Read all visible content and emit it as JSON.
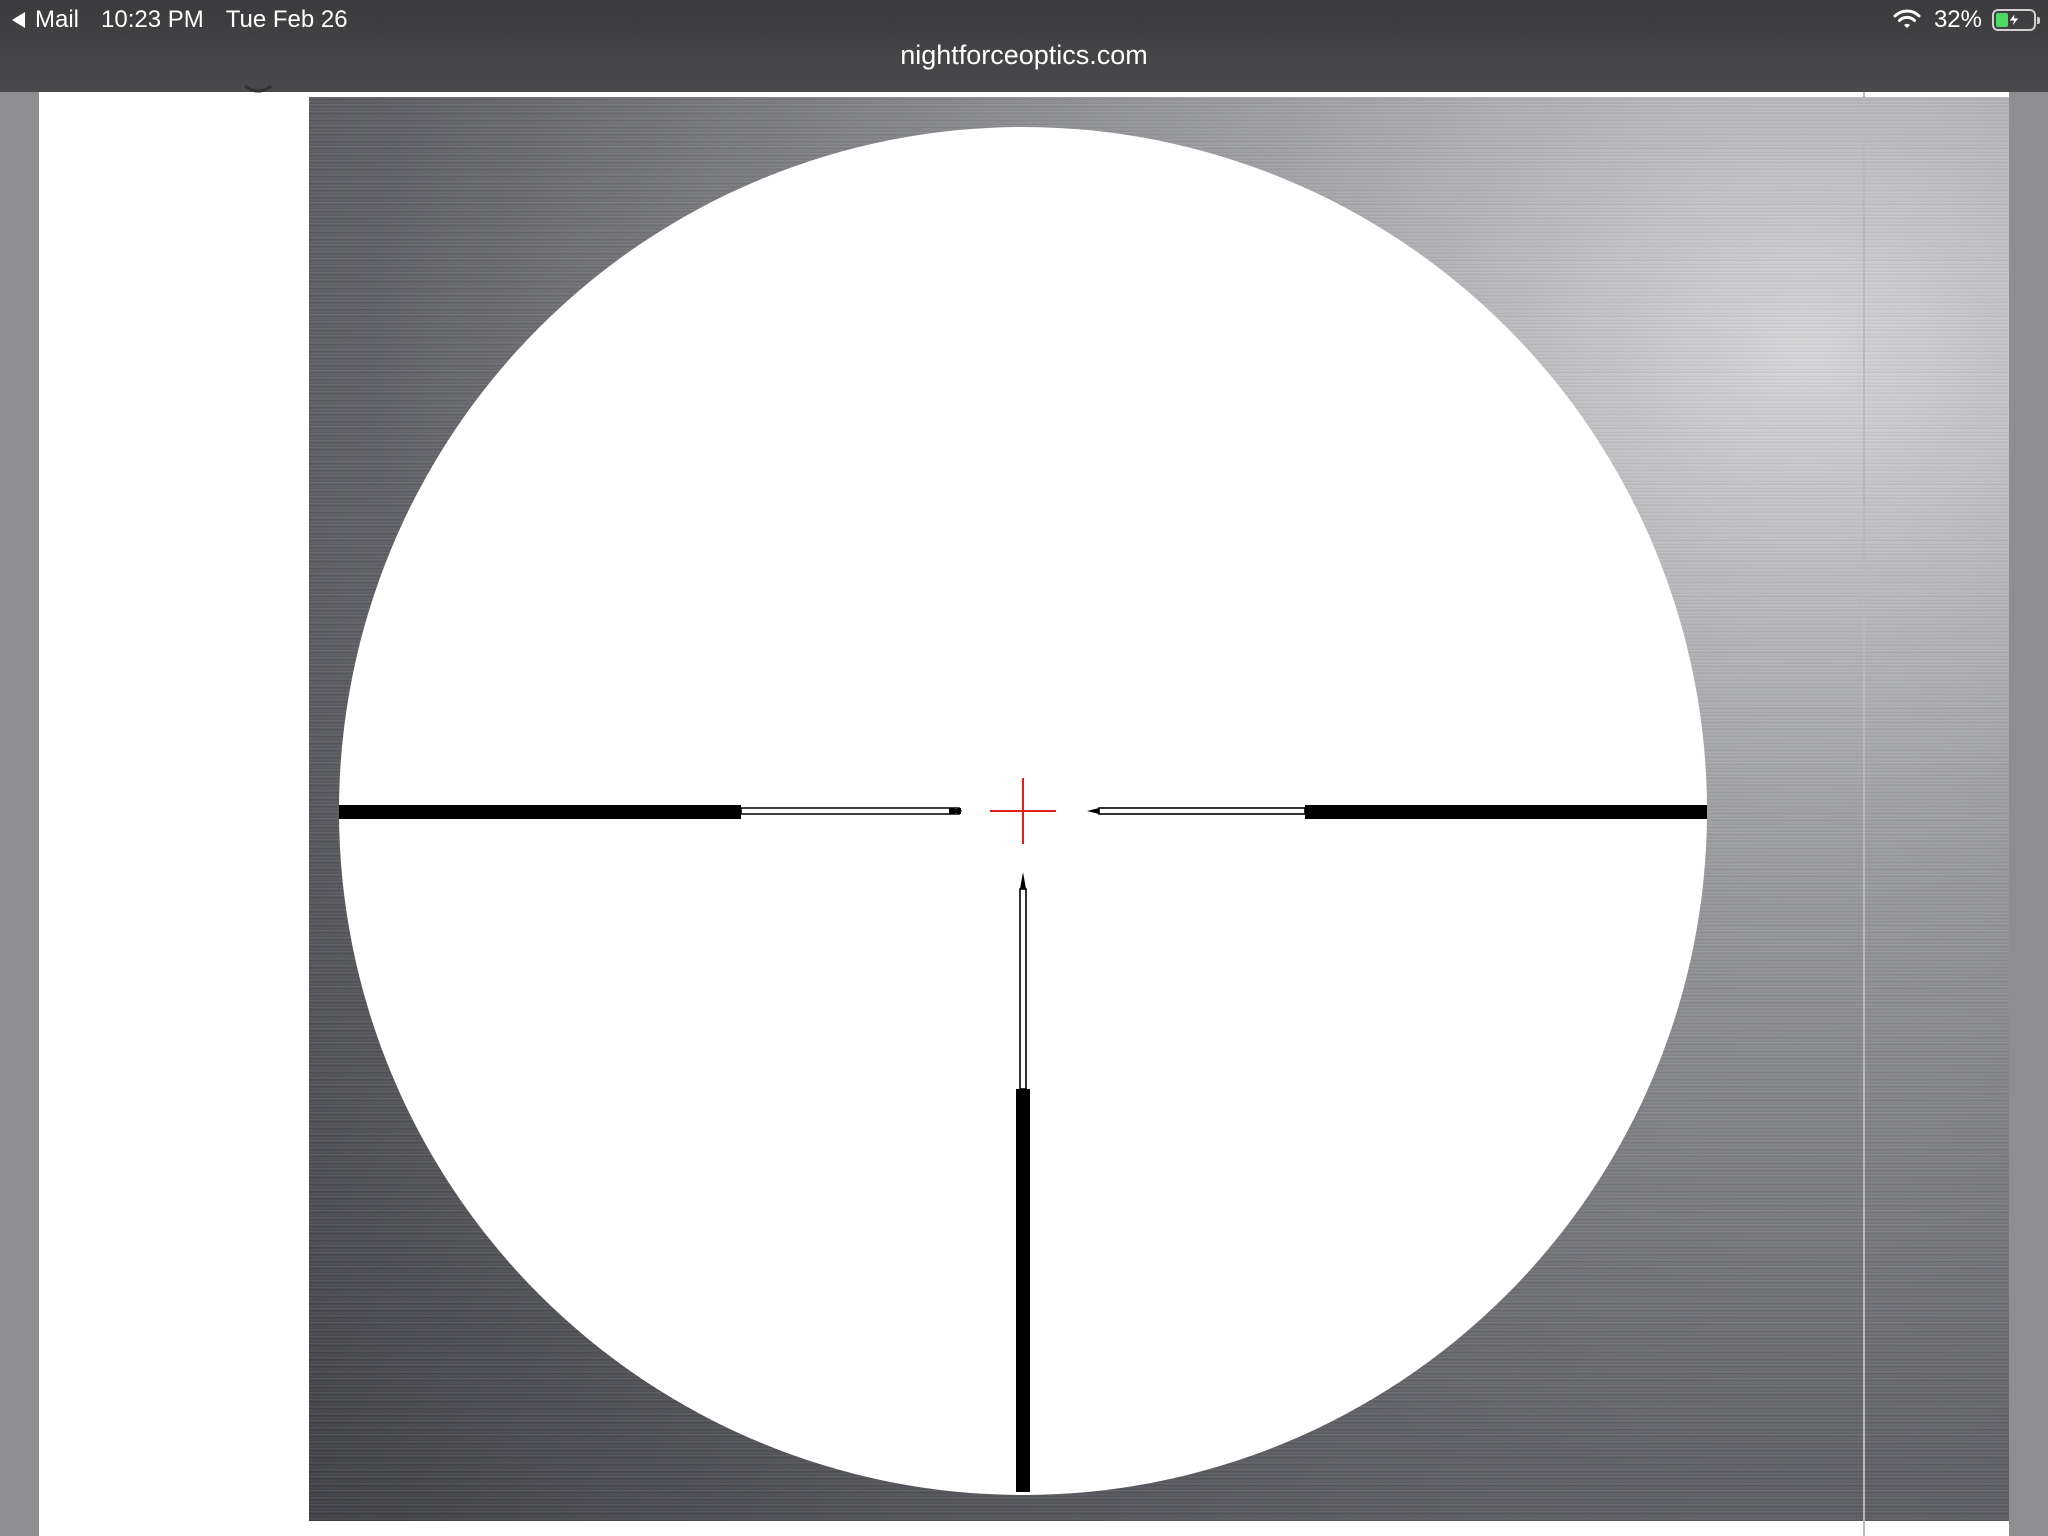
{
  "status_bar": {
    "back_label": "Mail",
    "time": "10:23 PM",
    "date": "Tue Feb 26",
    "battery_text": "32%",
    "battery_level": 0.32,
    "battery_fill_color": "#4cd964",
    "wifi_icon": "wifi-icon",
    "charging_icon": "bolt-icon"
  },
  "browser": {
    "url": "nightforceoptics.com"
  },
  "reticle_image": {
    "crosshair_color": "#e0201c",
    "post_color": "#000000",
    "field_color": "#ffffff"
  }
}
